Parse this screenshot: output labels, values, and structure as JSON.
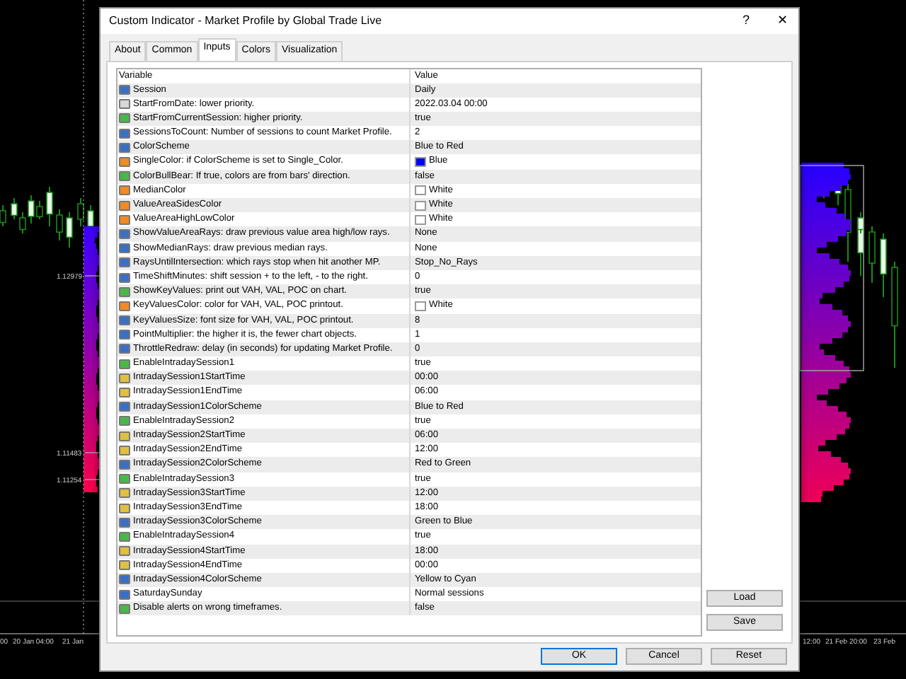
{
  "window": {
    "title": "Custom Indicator - Market Profile by Global Trade Live",
    "help": "?",
    "close": "✕"
  },
  "tabs": [
    {
      "label": "About",
      "selected": false
    },
    {
      "label": "Common",
      "selected": false
    },
    {
      "label": "Inputs",
      "selected": true
    },
    {
      "label": "Colors",
      "selected": false
    },
    {
      "label": "Visualization",
      "selected": false
    }
  ],
  "table": {
    "columns": [
      "Variable",
      "Value"
    ],
    "rows": [
      {
        "kind": "enum",
        "variable": "Session",
        "value": "Daily"
      },
      {
        "kind": "datetime",
        "variable": "StartFromDate: lower priority.",
        "value": "2022.03.04 00:00"
      },
      {
        "kind": "bool",
        "variable": "StartFromCurrentSession: higher priority.",
        "value": "true"
      },
      {
        "kind": "enum",
        "variable": "SessionsToCount: Number of sessions to count Market Profile.",
        "value": "2"
      },
      {
        "kind": "enum",
        "variable": "ColorScheme",
        "value": "Blue to Red"
      },
      {
        "kind": "color",
        "variable": "SingleColor: if ColorScheme is set to Single_Color.",
        "value": "Blue",
        "color": "#0000ff"
      },
      {
        "kind": "bool",
        "variable": "ColorBullBear: If true, colors are from bars' direction.",
        "value": "false"
      },
      {
        "kind": "color",
        "variable": "MedianColor",
        "value": "White",
        "color": "#ffffff"
      },
      {
        "kind": "color",
        "variable": "ValueAreaSidesColor",
        "value": "White",
        "color": "#ffffff"
      },
      {
        "kind": "color",
        "variable": "ValueAreaHighLowColor",
        "value": "White",
        "color": "#ffffff"
      },
      {
        "kind": "enum",
        "variable": "ShowValueAreaRays: draw previous value area high/low rays.",
        "value": "None"
      },
      {
        "kind": "enum",
        "variable": "ShowMedianRays: draw previous median rays.",
        "value": "None"
      },
      {
        "kind": "enum",
        "variable": "RaysUntilIntersection: which rays stop when hit another MP.",
        "value": "Stop_No_Rays"
      },
      {
        "kind": "enum",
        "variable": "TimeShiftMinutes: shift session + to the left, - to the right.",
        "value": "0"
      },
      {
        "kind": "bool",
        "variable": "ShowKeyValues: print out VAH, VAL, POC on chart.",
        "value": "true"
      },
      {
        "kind": "color",
        "variable": "KeyValuesColor: color for VAH, VAL, POC printout.",
        "value": "White",
        "color": "#ffffff"
      },
      {
        "kind": "enum",
        "variable": "KeyValuesSize: font size for VAH, VAL, POC printout.",
        "value": "8"
      },
      {
        "kind": "enum",
        "variable": "PointMultiplier: the higher it is, the fewer chart objects.",
        "value": "1"
      },
      {
        "kind": "enum",
        "variable": "ThrottleRedraw: delay (in seconds) for updating Market Profile.",
        "value": "0"
      },
      {
        "kind": "bool",
        "variable": "EnableIntradaySession1",
        "value": "true"
      },
      {
        "kind": "string",
        "variable": "IntradaySession1StartTime",
        "value": "00:00"
      },
      {
        "kind": "string",
        "variable": "IntradaySession1EndTime",
        "value": "06:00"
      },
      {
        "kind": "enum",
        "variable": "IntradaySession1ColorScheme",
        "value": "Blue to Red"
      },
      {
        "kind": "bool",
        "variable": "EnableIntradaySession2",
        "value": "true"
      },
      {
        "kind": "string",
        "variable": "IntradaySession2StartTime",
        "value": "06:00"
      },
      {
        "kind": "string",
        "variable": "IntradaySession2EndTime",
        "value": "12:00"
      },
      {
        "kind": "enum",
        "variable": "IntradaySession2ColorScheme",
        "value": "Red to Green"
      },
      {
        "kind": "bool",
        "variable": "EnableIntradaySession3",
        "value": "true"
      },
      {
        "kind": "string",
        "variable": "IntradaySession3StartTime",
        "value": "12:00"
      },
      {
        "kind": "string",
        "variable": "IntradaySession3EndTime",
        "value": "18:00"
      },
      {
        "kind": "enum",
        "variable": "IntradaySession3ColorScheme",
        "value": "Green to Blue"
      },
      {
        "kind": "bool",
        "variable": "EnableIntradaySession4",
        "value": "true"
      },
      {
        "kind": "string",
        "variable": "IntradaySession4StartTime",
        "value": "18:00"
      },
      {
        "kind": "string",
        "variable": "IntradaySession4EndTime",
        "value": "00:00"
      },
      {
        "kind": "enum",
        "variable": "IntradaySession4ColorScheme",
        "value": "Yellow to Cyan"
      },
      {
        "kind": "enum",
        "variable": "SaturdaySunday",
        "value": "Normal sessions"
      },
      {
        "kind": "bool",
        "variable": "Disable alerts on wrong timeframes.",
        "value": "false"
      }
    ]
  },
  "side_buttons": [
    "Load",
    "Save"
  ],
  "buttons": [
    "OK",
    "Cancel",
    "Reset"
  ],
  "chart": {
    "price_labels": [
      "1.12979",
      "1.11483",
      "1.11254"
    ],
    "left_dates": [
      "00",
      "20 Jan 04:00",
      "21 Jan"
    ],
    "right_dates": [
      "12:00",
      "21 Feb 20:00",
      "23 Feb"
    ]
  }
}
